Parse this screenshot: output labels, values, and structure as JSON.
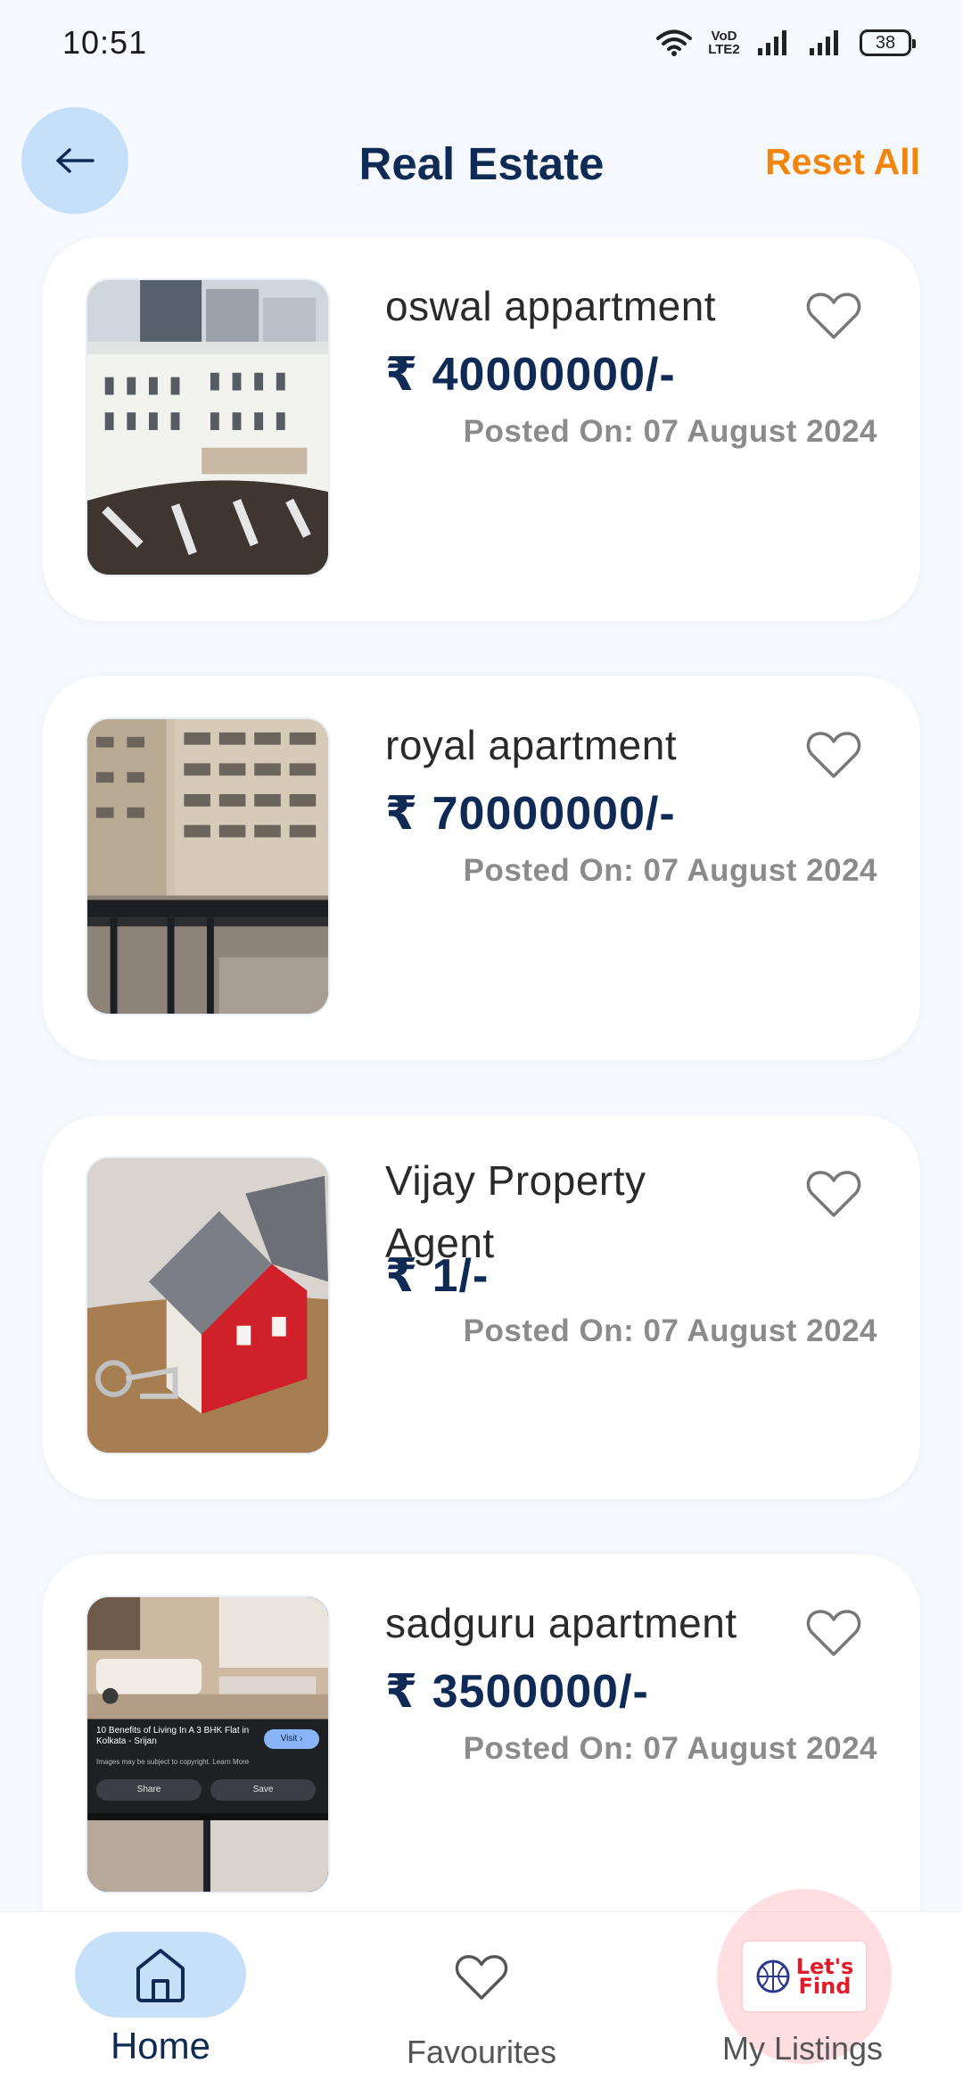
{
  "status_bar": {
    "time": "10:51",
    "network_label": "VoD LTE2",
    "battery": "38"
  },
  "header": {
    "title": "Real Estate",
    "reset_label": "Reset All"
  },
  "listings": [
    {
      "title": "oswal appartment",
      "price": "₹ 40000000/-",
      "posted": "Posted On: 07 August 2024",
      "favourite": false,
      "image": "apartment-building-photo"
    },
    {
      "title": "royal apartment",
      "price": "₹ 70000000/-",
      "posted": "Posted On: 07 August 2024",
      "favourite": false,
      "image": "balcony-view-photo"
    },
    {
      "title": "Vijay Property Agent",
      "price": "₹ 1/-",
      "posted": "Posted On: 07 August 2024",
      "favourite": false,
      "image": "house-with-keys-photo"
    },
    {
      "title": "sadguru apartment",
      "price": "₹ 3500000/-",
      "posted": "Posted On: 07 August 2024",
      "favourite": false,
      "image": "interior-screenshot-photo"
    }
  ],
  "thumb_caption": {
    "headline": "10 Benefits of Living In A 3 BHK Flat in Kolkata - Srijan",
    "visit": "Visit",
    "note": "Images may be subject to copyright. Learn More",
    "share": "Share",
    "save": "Save"
  },
  "bottom_nav": {
    "home": "Home",
    "favourites": "Favourites",
    "my_listings": "My Listings",
    "logo_text_line1": "Let's",
    "logo_text_line2": "Find"
  },
  "colors": {
    "accent_orange": "#f2860d",
    "navy": "#0f2b55",
    "light_blue": "#c7e0fa",
    "background": "#f5f9fd"
  }
}
